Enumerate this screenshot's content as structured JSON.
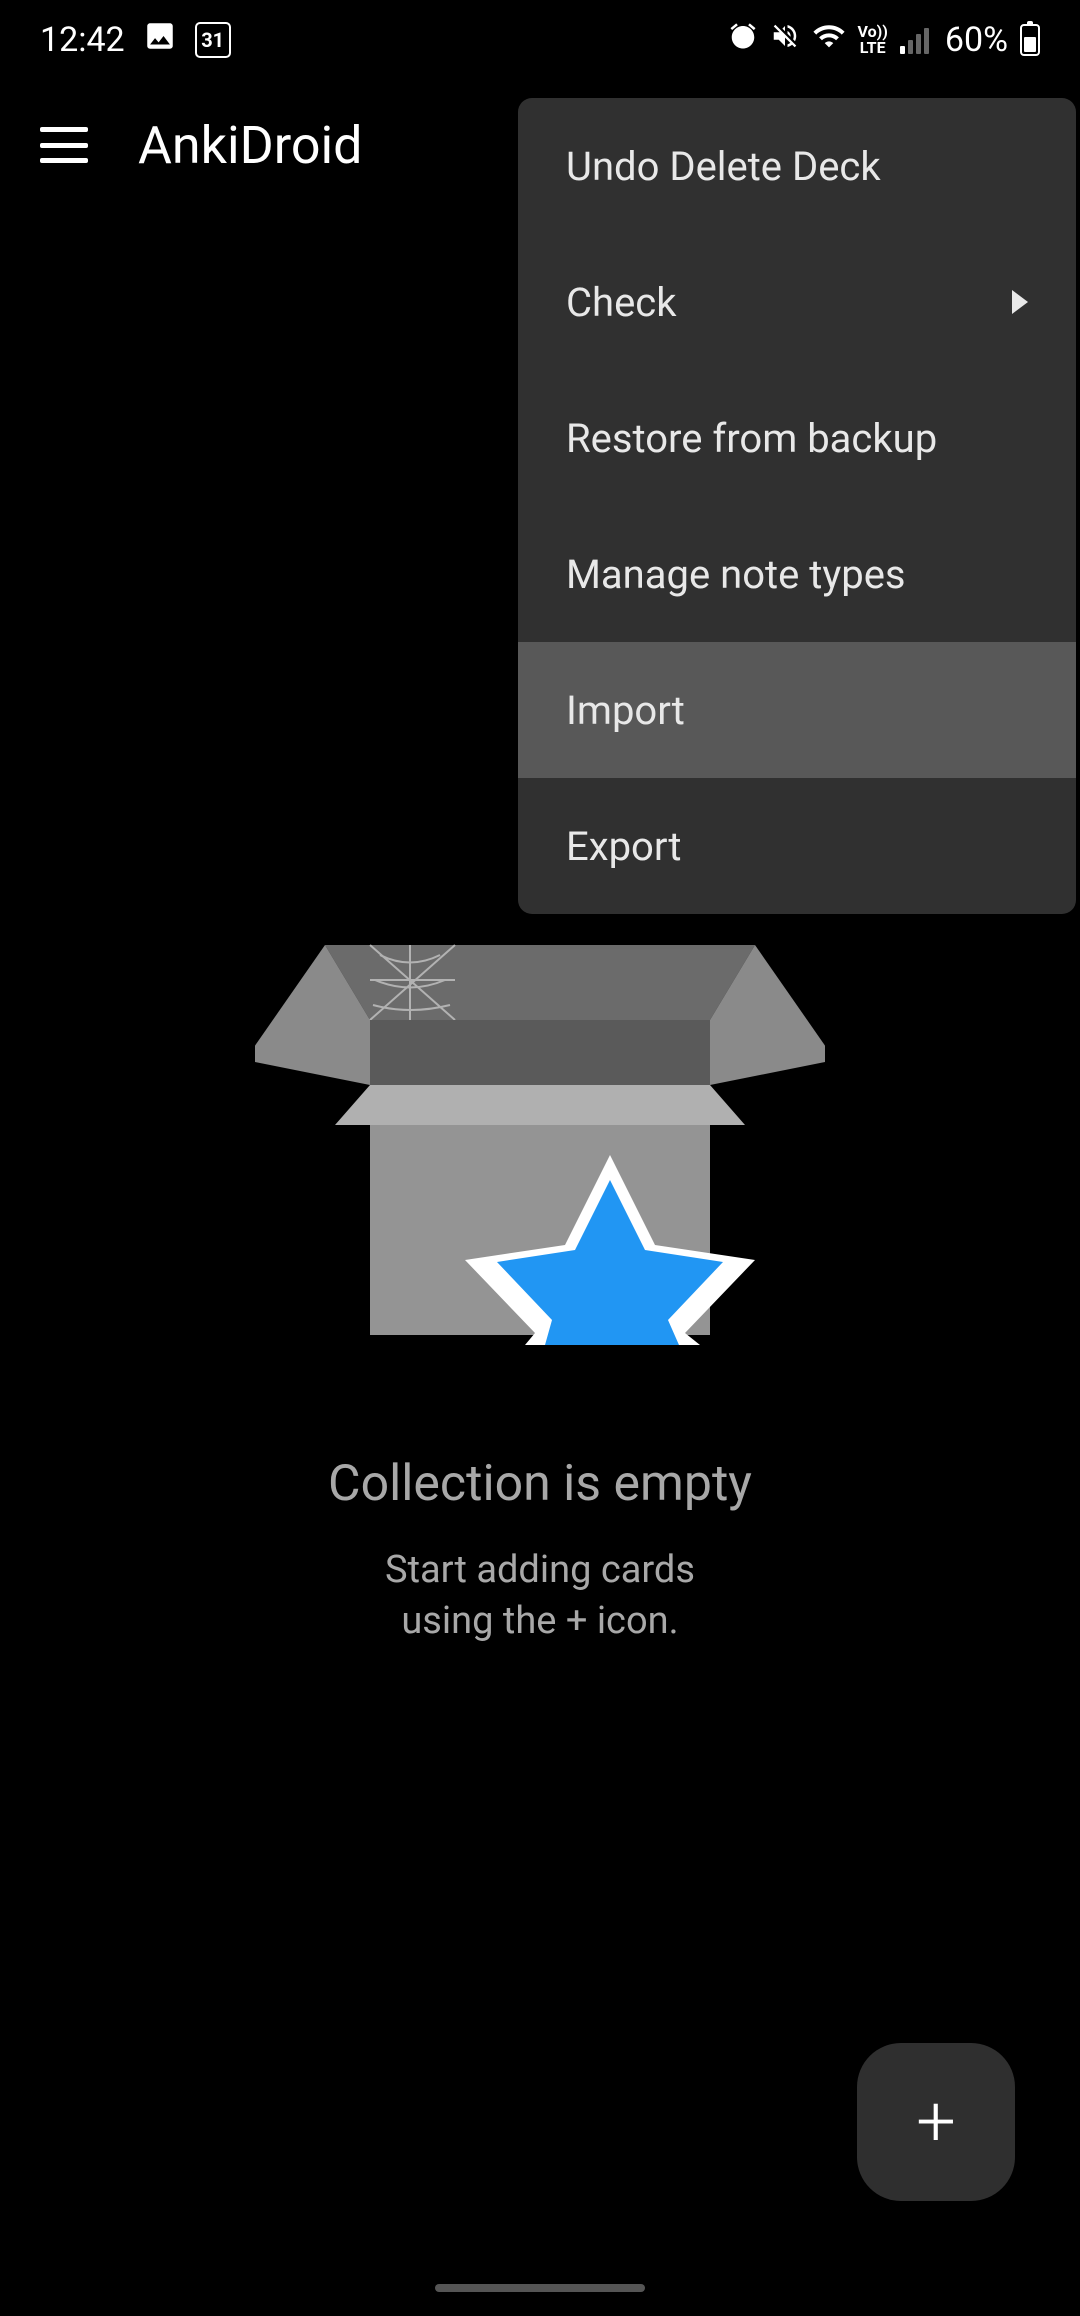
{
  "status_bar": {
    "time": "12:42",
    "calendar_day": "31",
    "network_label": "Vo))\nLTE",
    "battery_percent": "60%"
  },
  "app_bar": {
    "title": "AnkiDroid"
  },
  "menu": {
    "items": [
      {
        "label": "Undo Delete Deck",
        "has_submenu": false,
        "highlighted": false
      },
      {
        "label": "Check",
        "has_submenu": true,
        "highlighted": false
      },
      {
        "label": "Restore from backup",
        "has_submenu": false,
        "highlighted": false
      },
      {
        "label": "Manage note types",
        "has_submenu": false,
        "highlighted": false
      },
      {
        "label": "Import",
        "has_submenu": false,
        "highlighted": true
      },
      {
        "label": "Export",
        "has_submenu": false,
        "highlighted": false
      }
    ]
  },
  "empty_state": {
    "title": "Collection is empty",
    "subtitle_line1": "Start adding cards",
    "subtitle_line2": "using the + icon."
  }
}
